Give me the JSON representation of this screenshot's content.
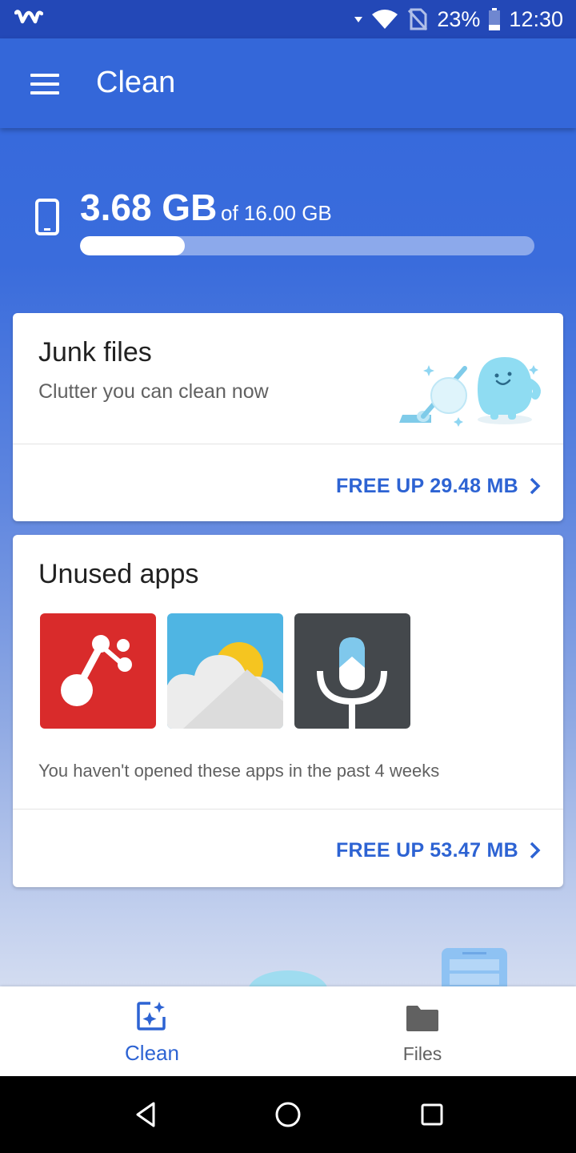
{
  "status_bar": {
    "battery": "23%",
    "time": "12:30"
  },
  "app_bar": {
    "title": "Clean"
  },
  "storage": {
    "used": "3.68 GB",
    "total": "of 16.00 GB",
    "used_fraction": 0.23
  },
  "junk_card": {
    "title": "Junk files",
    "subtitle": "Clutter you can clean now",
    "action": "FREE UP 29.48 MB"
  },
  "unused_card": {
    "title": "Unused apps",
    "apps": [
      "git-app-icon",
      "weather-app-icon",
      "voice-app-icon"
    ],
    "subtitle": "You haven't opened these apps in the past 4 weeks",
    "action": "FREE UP 53.47 MB"
  },
  "bottom_nav": {
    "items": [
      {
        "label": "Clean",
        "icon": "clean-icon",
        "active": true
      },
      {
        "label": "Files",
        "icon": "folder-icon",
        "active": false
      }
    ]
  },
  "colors": {
    "accent": "#2d63d3",
    "app_bar": "#3467d9",
    "status_bar": "#2348b7"
  }
}
